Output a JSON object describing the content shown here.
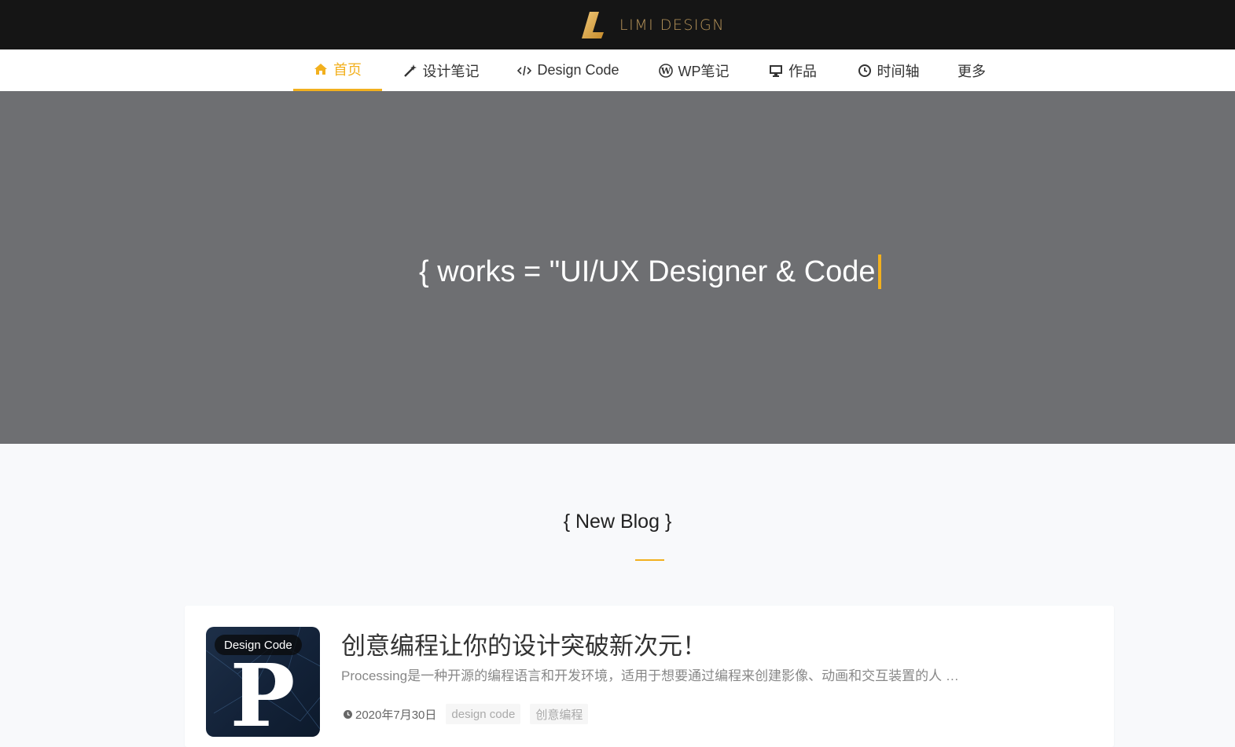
{
  "header": {
    "logo_text": "LIMI DESIGN",
    "brand_color": "#b8955a"
  },
  "nav": {
    "accent": "#f2b01e",
    "items": [
      {
        "label": "首页",
        "icon": "home-icon",
        "active": true
      },
      {
        "label": "设计笔记",
        "icon": "magic-wand-icon",
        "active": false
      },
      {
        "label": "Design Code",
        "icon": "code-icon",
        "active": false
      },
      {
        "label": "WP笔记",
        "icon": "wordpress-icon",
        "active": false
      },
      {
        "label": "作品",
        "icon": "desktop-icon",
        "active": false
      },
      {
        "label": "时间轴",
        "icon": "clock-icon",
        "active": false
      },
      {
        "label": "更多",
        "icon": "",
        "active": false
      }
    ]
  },
  "hero": {
    "typed_text": "{ works = \"UI/UX Designer & Code"
  },
  "section": {
    "title": "{ New Blog }"
  },
  "posts": [
    {
      "category_badge": "Design Code",
      "thumb_letter": "P",
      "title": "创意编程让你的设计突破新次元！",
      "excerpt": "Processing是一种开源的编程语言和开发环境，适用于想要通过编程来创建影像、动画和交互装置的人 …",
      "date": "2020年7月30日",
      "tags": [
        "design code",
        "创意编程"
      ]
    }
  ]
}
